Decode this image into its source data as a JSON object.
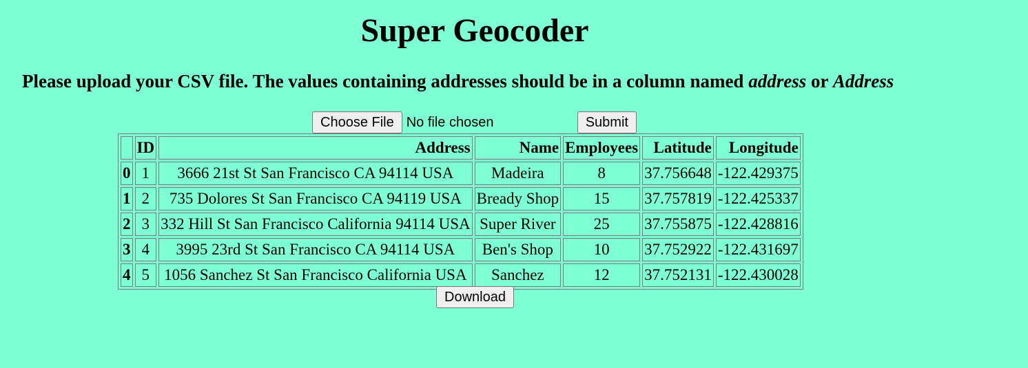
{
  "page": {
    "title": "Super Geocoder",
    "instructions_prefix": "Please upload your CSV file. The values containing addresses should be in a column named ",
    "instructions_em1": "address",
    "instructions_mid": " or ",
    "instructions_em2": "Address"
  },
  "form": {
    "choose_file_label": "Choose File",
    "file_status": "No file chosen",
    "submit_label": "Submit"
  },
  "table": {
    "headers": [
      "",
      "ID",
      "Address",
      "Name",
      "Employees",
      "Latitude",
      "Longitude"
    ],
    "rows": [
      {
        "index": "0",
        "id": "1",
        "address": "3666 21st St San Francisco CA 94114 USA",
        "name": "Madeira",
        "employees": "8",
        "latitude": "37.756648",
        "longitude": "-122.429375"
      },
      {
        "index": "1",
        "id": "2",
        "address": "735 Dolores St San Francisco CA 94119 USA",
        "name": "Bready Shop",
        "employees": "15",
        "latitude": "37.757819",
        "longitude": "-122.425337"
      },
      {
        "index": "2",
        "id": "3",
        "address": "332 Hill St San Francisco California 94114 USA",
        "name": "Super River",
        "employees": "25",
        "latitude": "37.755875",
        "longitude": "-122.428816"
      },
      {
        "index": "3",
        "id": "4",
        "address": "3995 23rd St San Francisco CA 94114 USA",
        "name": "Ben's Shop",
        "employees": "10",
        "latitude": "37.752922",
        "longitude": "-122.431697"
      },
      {
        "index": "4",
        "id": "5",
        "address": "1056 Sanchez St San Francisco California USA",
        "name": "Sanchez",
        "employees": "12",
        "latitude": "37.752131",
        "longitude": "-122.430028"
      }
    ]
  },
  "download": {
    "label": "Download"
  },
  "colors": {
    "background": "#7fffd4"
  }
}
